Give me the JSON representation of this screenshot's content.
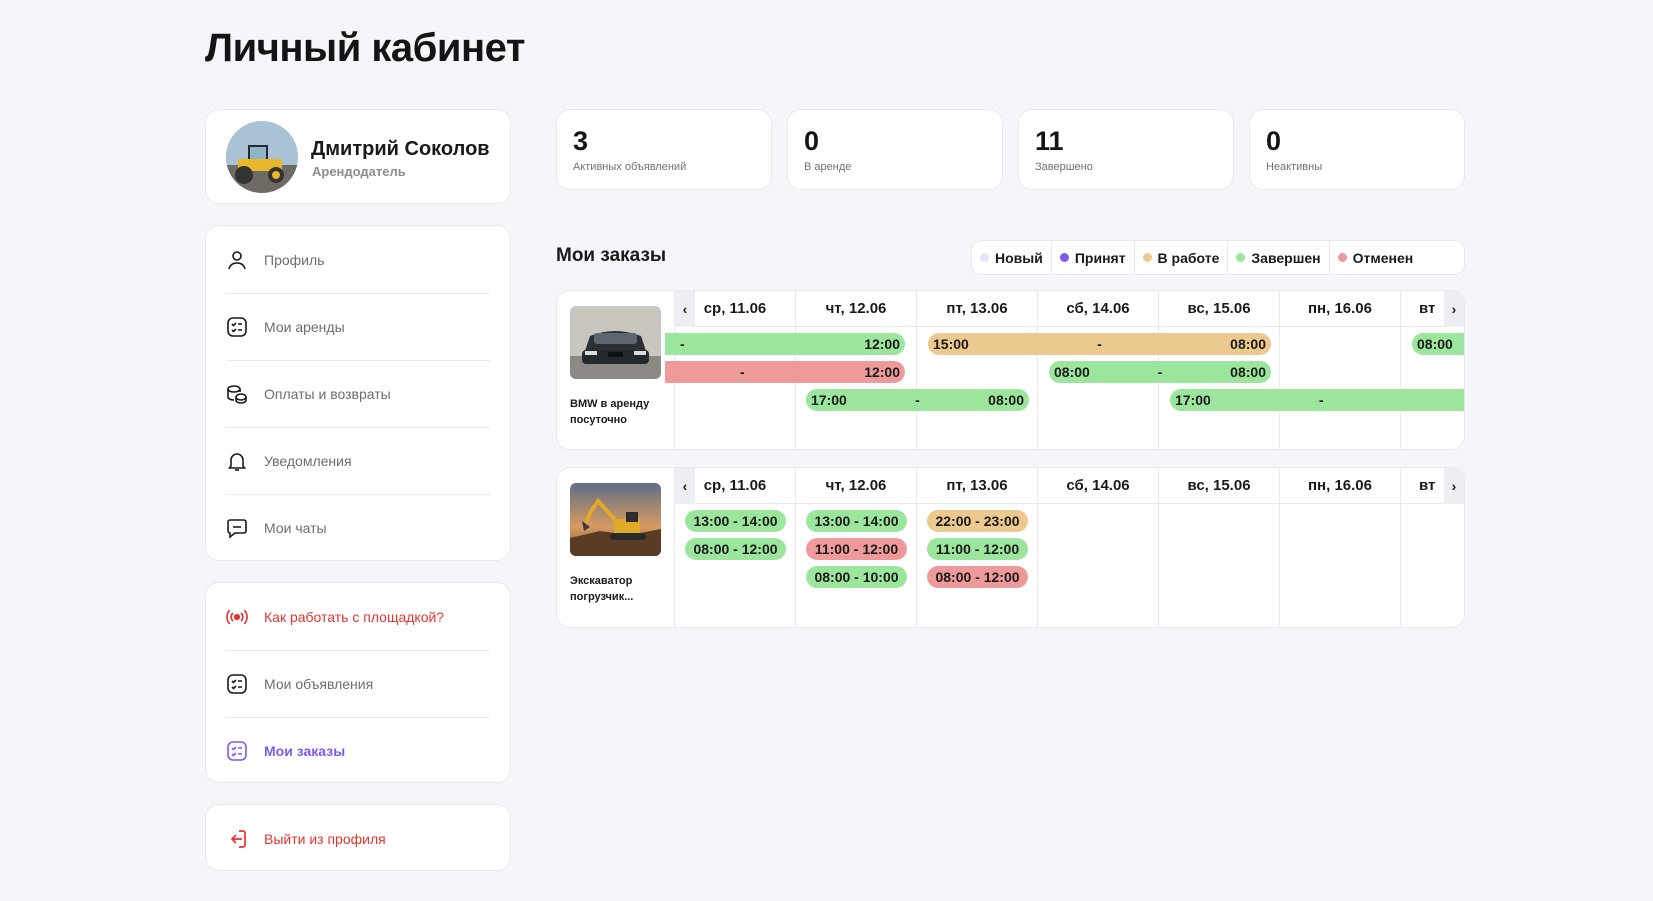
{
  "page_title": "Личный кабинет",
  "profile": {
    "name": "Дмитрий Соколов",
    "role": "Арендодатель"
  },
  "menu": {
    "main": [
      {
        "label": "Профиль",
        "icon": "user-icon"
      },
      {
        "label": "Мои аренды",
        "icon": "checklist-icon"
      },
      {
        "label": "Оплаты и возвраты",
        "icon": "coins-icon"
      },
      {
        "label": "Уведомления",
        "icon": "bell-icon"
      },
      {
        "label": "Мои чаты",
        "icon": "chat-icon"
      }
    ],
    "secondary": [
      {
        "label": "Как работать с площадкой?",
        "icon": "broadcast-icon"
      },
      {
        "label": "Мои объявления",
        "icon": "checklist-icon"
      },
      {
        "label": "Мои заказы",
        "icon": "checklist-icon"
      }
    ],
    "logout": "Выйти из профиля"
  },
  "stats": [
    {
      "value": "3",
      "label": "Активных объявлений"
    },
    {
      "value": "0",
      "label": "В аренде"
    },
    {
      "value": "11",
      "label": "Завершено"
    },
    {
      "value": "0",
      "label": "Неактивны"
    }
  ],
  "orders": {
    "title": "Мои заказы",
    "legend": [
      {
        "label": "Новый",
        "color": "#e6e4f4"
      },
      {
        "label": "Принят",
        "color": "#7b5cf0"
      },
      {
        "label": "В работе",
        "color": "#ecc98e"
      },
      {
        "label": "Завершен",
        "color": "#9ce59d"
      },
      {
        "label": "Отменен",
        "color": "#ef9a9a"
      }
    ],
    "colors": {
      "green": "#9ce59d",
      "red": "#ef9a9a",
      "amber": "#ecc98e"
    },
    "days": [
      "ср, 11.06",
      "чт, 12.06",
      "пт, 13.06",
      "сб, 14.06",
      "вс, 15.06",
      "пн, 16.06",
      "вт"
    ],
    "listings": [
      {
        "title": "BMW в аренду посуточно",
        "bars": [
          {
            "start": "",
            "sep": "-",
            "end": "12:00",
            "status": "green"
          },
          {
            "start": "15:00",
            "sep": "-",
            "end": "08:00",
            "status": "amber"
          },
          {
            "start": "08:00",
            "sep": "",
            "end": "",
            "status": "green"
          },
          {
            "start": "",
            "sep": "-",
            "end": "12:00",
            "status": "red"
          },
          {
            "start": "08:00",
            "sep": "-",
            "end": "08:00",
            "status": "green"
          },
          {
            "start": "17:00",
            "sep": "-",
            "end": "08:00",
            "status": "green"
          },
          {
            "start": "17:00",
            "sep": "-",
            "end": "",
            "status": "green"
          }
        ]
      },
      {
        "title": "Экскаватор погрузчик...",
        "slots": [
          {
            "text": "13:00 - 14:00",
            "status": "green"
          },
          {
            "text": "08:00 - 12:00",
            "status": "green"
          },
          {
            "text": "13:00 - 14:00",
            "status": "green"
          },
          {
            "text": "11:00 - 12:00",
            "status": "red"
          },
          {
            "text": "08:00 - 10:00",
            "status": "green"
          },
          {
            "text": "22:00 - 23:00",
            "status": "amber"
          },
          {
            "text": "11:00 - 12:00",
            "status": "green"
          },
          {
            "text": "08:00 - 12:00",
            "status": "red"
          }
        ]
      }
    ]
  }
}
